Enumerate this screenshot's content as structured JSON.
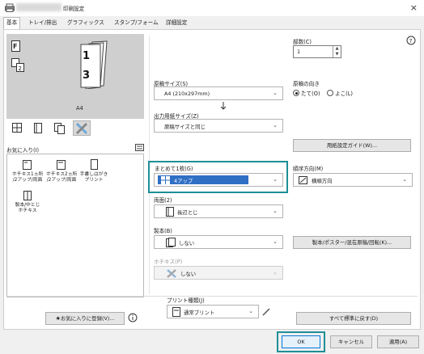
{
  "window": {
    "title": "印刷設定",
    "close_glyph": "×"
  },
  "tabs": [
    "基本",
    "トレイ/排出",
    "グラフィックス",
    "スタンプ/フォーム",
    "詳細設定"
  ],
  "preview": {
    "paper_label": "A4",
    "page_numbers": [
      "1",
      "3"
    ],
    "view_icons": [
      "single-page-icon",
      "book-icon",
      "duplicate-page-icon",
      "tools-icon"
    ]
  },
  "favorites": {
    "label": "お気に入り(I)",
    "items": [
      {
        "label": "ホチキス1ヵ所\n/2アップ/両面"
      },
      {
        "label": "ホチキス2ヵ所\n/2アップ/両面"
      },
      {
        "label": "手書しはがき\nプリント"
      },
      {
        "label": "製本/中とじ\nホチキス"
      }
    ],
    "register_button": "お気に入りに登録(V)..."
  },
  "copies": {
    "label": "部数(C)",
    "value": "1"
  },
  "orientation": {
    "label": "原稿の向き",
    "options": [
      "たて(O)",
      "よこ(L)"
    ],
    "selected": 0
  },
  "original_size": {
    "label": "原稿サイズ(S)",
    "value": "A4 (210x297mm)"
  },
  "output_size": {
    "label": "出力用紙サイズ(Z)",
    "value": "原稿サイズと同じ"
  },
  "paper_settings_button": "用紙設定ガイド(W)...",
  "nup": {
    "label": "まとめて1枚(G)",
    "value": "4アップ"
  },
  "layout_dir": {
    "label": "順序方向(M)",
    "value": "横順方向"
  },
  "duplex": {
    "label": "両面(2)",
    "value": "長辺とじ"
  },
  "binding": {
    "label": "製本(B)",
    "value": "しない"
  },
  "booklet_button": "製本/ポスター/混在原稿/回転(K)...",
  "staple": {
    "label": "ホチキス(P)",
    "value": "しない"
  },
  "print_type": {
    "label": "プリント種類(J)",
    "value": "通常プリント"
  },
  "reset_button": "すべて標準に戻す(D)",
  "footer": {
    "ok": "OK",
    "cancel": "キャンセル",
    "apply": "適用(A)"
  },
  "colors": {
    "accent": "#1e8f96",
    "selected_blue": "#2f6fc4"
  }
}
